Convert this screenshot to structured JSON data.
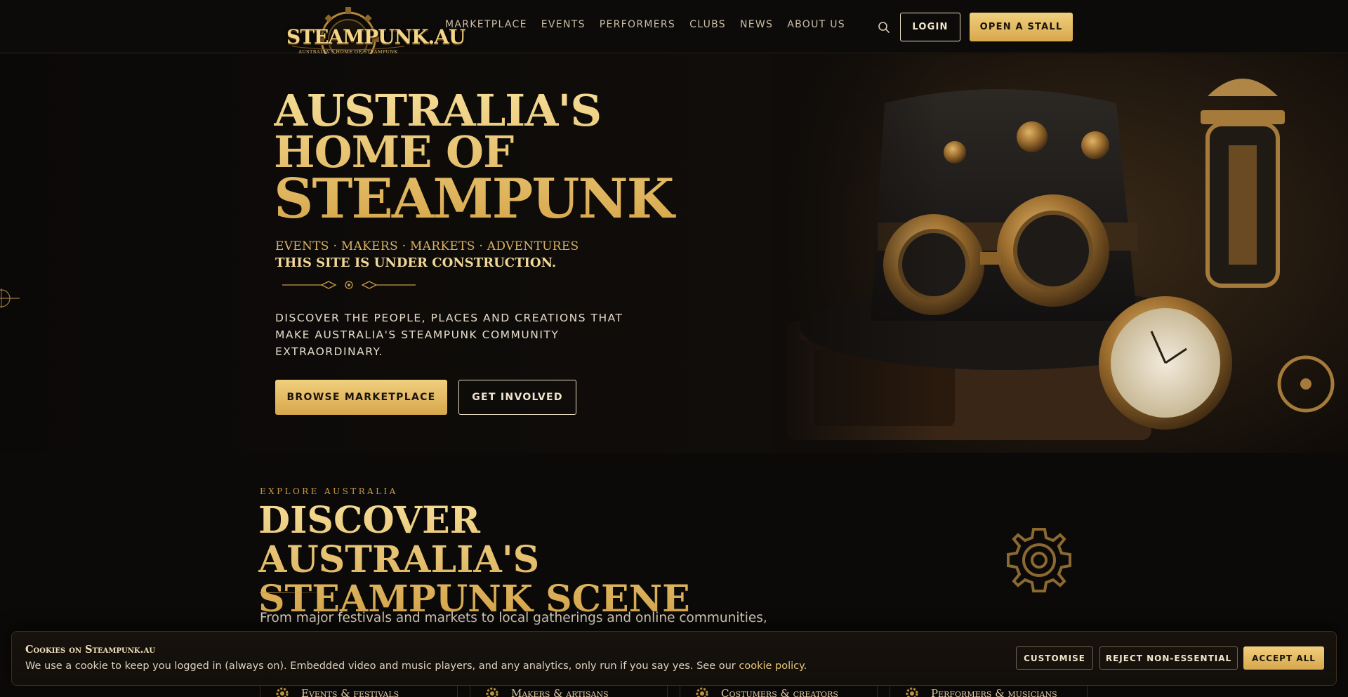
{
  "header": {
    "logo_word": "STEAMPUNK.AU",
    "logo_tagline": "AUSTRALIA'S HOME OF STEAMPUNK",
    "nav": [
      "MARKETPLACE",
      "EVENTS",
      "PERFORMERS",
      "CLUBS",
      "NEWS",
      "ABOUT US"
    ],
    "search_icon": "search-icon",
    "login_label": "LOGIN",
    "stall_label": "OPEN A STALL"
  },
  "hero": {
    "title_line1": "AUSTRALIA'S",
    "title_line2": "HOME OF",
    "title_line3": "STEAMPUNK",
    "kicker": "EVENTS · MAKERS · MARKETS · ADVENTURES",
    "construction": "THIS SITE IS UNDER CONSTRUCTION.",
    "lead": "DISCOVER THE PEOPLE, PLACES AND CREATIONS THAT MAKE AUSTRALIA'S STEAMPUNK COMMUNITY EXTRAORDINARY.",
    "browse_label": "BROWSE MARKETPLACE",
    "involved_label": "GET INVOLVED"
  },
  "explore": {
    "eyebrow": "EXPLORE AUSTRALIA",
    "title_line1": "DISCOVER AUSTRALIA'S",
    "title_line2": "STEAMPUNK SCENE",
    "text": "From major festivals and markets to local gatherings and online communities,",
    "cards": [
      "Events & festivals",
      "Makers & artisans",
      "Costumers & creators",
      "Performers & musicians"
    ]
  },
  "cookie": {
    "title": "Cookies on Steampunk.au",
    "text": "We use a cookie to keep you logged in (always on). Embedded video and music players, and any analytics, only run if you say yes. See our",
    "link": "cookie policy",
    "text_end": ".",
    "customise_label": "CUSTOMISE",
    "reject_label": "REJECT NON-ESSENTIAL",
    "accept_label": "ACCEPT ALL"
  },
  "colors": {
    "background": "#0c0a08",
    "gold": "#e9c776",
    "gold_dark": "#d7a74c",
    "text": "#e6dccb"
  }
}
